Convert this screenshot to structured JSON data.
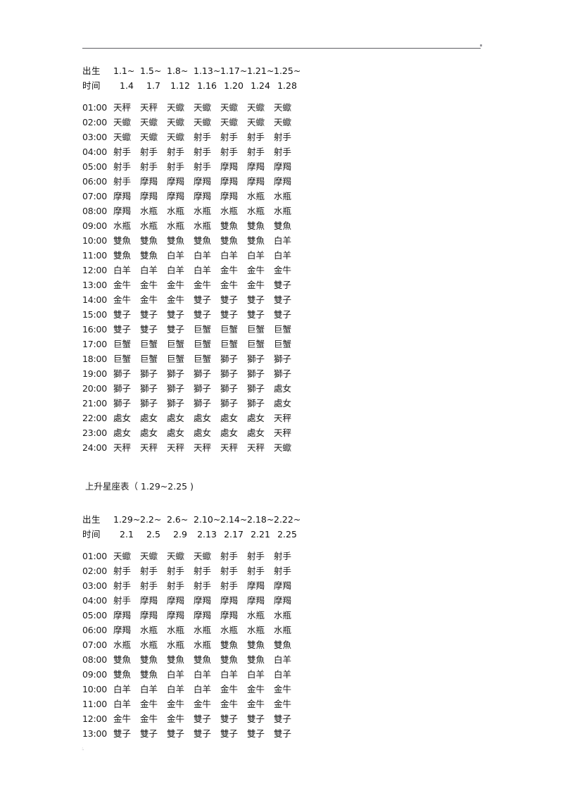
{
  "document": {
    "header_rule": "horizontal-rule",
    "footer_mark": ":."
  },
  "table1": {
    "birth_label": "出生",
    "time_label": "时间",
    "range_start": [
      "1.1~",
      "1.5~",
      "1.8~",
      "1.13~",
      "1.17~",
      "1.21~",
      "1.25~"
    ],
    "range_end": [
      "1.4",
      "1.7",
      "1.12",
      "1.16",
      "1.20",
      "1.24",
      "1.28"
    ],
    "rows": [
      {
        "hour": "01:00",
        "signs": [
          "天秤",
          "天秤",
          "天蠍",
          "天蠍",
          "天蠍",
          "天蠍",
          "天蠍"
        ]
      },
      {
        "hour": "02:00",
        "signs": [
          "天蠍",
          "天蠍",
          "天蠍",
          "天蠍",
          "天蠍",
          "天蠍",
          "天蠍"
        ]
      },
      {
        "hour": "03:00",
        "signs": [
          "天蠍",
          "天蠍",
          "天蠍",
          "射手",
          "射手",
          "射手",
          "射手"
        ]
      },
      {
        "hour": "04:00",
        "signs": [
          "射手",
          "射手",
          "射手",
          "射手",
          "射手",
          "射手",
          "射手"
        ]
      },
      {
        "hour": "05:00",
        "signs": [
          "射手",
          "射手",
          "射手",
          "射手",
          "摩羯",
          "摩羯",
          "摩羯"
        ]
      },
      {
        "hour": "06:00",
        "signs": [
          "射手",
          "摩羯",
          "摩羯",
          "摩羯",
          "摩羯",
          "摩羯",
          "摩羯"
        ]
      },
      {
        "hour": "07:00",
        "signs": [
          "摩羯",
          "摩羯",
          "摩羯",
          "摩羯",
          "摩羯",
          "水瓶",
          "水瓶"
        ]
      },
      {
        "hour": "08:00",
        "signs": [
          "摩羯",
          "水瓶",
          "水瓶",
          "水瓶",
          "水瓶",
          "水瓶",
          "水瓶"
        ]
      },
      {
        "hour": "09:00",
        "signs": [
          "水瓶",
          "水瓶",
          "水瓶",
          "水瓶",
          "雙魚",
          "雙魚",
          "雙魚"
        ]
      },
      {
        "hour": "10:00",
        "signs": [
          "雙魚",
          "雙魚",
          "雙魚",
          "雙魚",
          "雙魚",
          "雙魚",
          "白羊"
        ]
      },
      {
        "hour": "11:00",
        "signs": [
          "雙魚",
          "雙魚",
          "白羊",
          "白羊",
          "白羊",
          "白羊",
          "白羊"
        ]
      },
      {
        "hour": "12:00",
        "signs": [
          "白羊",
          "白羊",
          "白羊",
          "白羊",
          "金牛",
          "金牛",
          "金牛"
        ]
      },
      {
        "hour": "13:00",
        "signs": [
          "金牛",
          "金牛",
          "金牛",
          "金牛",
          "金牛",
          "金牛",
          "雙子"
        ]
      },
      {
        "hour": "14:00",
        "signs": [
          "金牛",
          "金牛",
          "金牛",
          "雙子",
          "雙子",
          "雙子",
          "雙子"
        ]
      },
      {
        "hour": "15:00",
        "signs": [
          "雙子",
          "雙子",
          "雙子",
          "雙子",
          "雙子",
          "雙子",
          "雙子"
        ]
      },
      {
        "hour": "16:00",
        "signs": [
          "雙子",
          "雙子",
          "雙子",
          "巨蟹",
          "巨蟹",
          "巨蟹",
          "巨蟹"
        ]
      },
      {
        "hour": "17:00",
        "signs": [
          "巨蟹",
          "巨蟹",
          "巨蟹",
          "巨蟹",
          "巨蟹",
          "巨蟹",
          "巨蟹"
        ]
      },
      {
        "hour": "18:00",
        "signs": [
          "巨蟹",
          "巨蟹",
          "巨蟹",
          "巨蟹",
          "獅子",
          "獅子",
          "獅子"
        ]
      },
      {
        "hour": "19:00",
        "signs": [
          "獅子",
          "獅子",
          "獅子",
          "獅子",
          "獅子",
          "獅子",
          "獅子"
        ]
      },
      {
        "hour": "20:00",
        "signs": [
          "獅子",
          "獅子",
          "獅子",
          "獅子",
          "獅子",
          "獅子",
          "處女"
        ]
      },
      {
        "hour": "21:00",
        "signs": [
          "獅子",
          "獅子",
          "獅子",
          "獅子",
          "獅子",
          "獅子",
          "處女"
        ]
      },
      {
        "hour": "22:00",
        "signs": [
          "處女",
          "處女",
          "處女",
          "處女",
          "處女",
          "處女",
          "天秤"
        ]
      },
      {
        "hour": "23:00",
        "signs": [
          "處女",
          "處女",
          "處女",
          "處女",
          "處女",
          "處女",
          "天秤"
        ]
      },
      {
        "hour": "24:00",
        "signs": [
          "天秤",
          "天秤",
          "天秤",
          "天秤",
          "天秤",
          "天秤",
          "天蠍"
        ]
      }
    ]
  },
  "section2": {
    "title": "上升星座表（ 1.29~2.25 )"
  },
  "table2": {
    "birth_label": "出生",
    "time_label": "时间",
    "range_start": [
      "1.29~",
      "2.2~",
      "2.6~",
      "2.10~",
      "2.14~",
      "2.18~",
      "2.22~"
    ],
    "range_end": [
      "2.1",
      "2.5",
      "2.9",
      "2.13",
      "2.17",
      "2.21",
      "2.25"
    ],
    "rows": [
      {
        "hour": "01:00",
        "signs": [
          "天蠍",
          "天蠍",
          "天蠍",
          "天蠍",
          "射手",
          "射手",
          "射手"
        ]
      },
      {
        "hour": "02:00",
        "signs": [
          "射手",
          "射手",
          "射手",
          "射手",
          "射手",
          "射手",
          "射手"
        ]
      },
      {
        "hour": "03:00",
        "signs": [
          "射手",
          "射手",
          "射手",
          "射手",
          "射手",
          "摩羯",
          "摩羯"
        ]
      },
      {
        "hour": "04:00",
        "signs": [
          "射手",
          "摩羯",
          "摩羯",
          "摩羯",
          "摩羯",
          "摩羯",
          "摩羯"
        ]
      },
      {
        "hour": "05:00",
        "signs": [
          "摩羯",
          "摩羯",
          "摩羯",
          "摩羯",
          "摩羯",
          "水瓶",
          "水瓶"
        ]
      },
      {
        "hour": "06:00",
        "signs": [
          "摩羯",
          "水瓶",
          "水瓶",
          "水瓶",
          "水瓶",
          "水瓶",
          "水瓶"
        ]
      },
      {
        "hour": "07:00",
        "signs": [
          "水瓶",
          "水瓶",
          "水瓶",
          "水瓶",
          "雙魚",
          "雙魚",
          "雙魚"
        ]
      },
      {
        "hour": "08:00",
        "signs": [
          "雙魚",
          "雙魚",
          "雙魚",
          "雙魚",
          "雙魚",
          "雙魚",
          "白羊"
        ]
      },
      {
        "hour": "09:00",
        "signs": [
          "雙魚",
          "雙魚",
          "白羊",
          "白羊",
          "白羊",
          "白羊",
          "白羊"
        ]
      },
      {
        "hour": "10:00",
        "signs": [
          "白羊",
          "白羊",
          "白羊",
          "白羊",
          "金牛",
          "金牛",
          "金牛"
        ]
      },
      {
        "hour": "11:00",
        "signs": [
          "白羊",
          "金牛",
          "金牛",
          "金牛",
          "金牛",
          "金牛",
          "金牛"
        ]
      },
      {
        "hour": "12:00",
        "signs": [
          "金牛",
          "金牛",
          "金牛",
          "雙子",
          "雙子",
          "雙子",
          "雙子"
        ]
      },
      {
        "hour": "13:00",
        "signs": [
          "雙子",
          "雙子",
          "雙子",
          "雙子",
          "雙子",
          "雙子",
          "雙子"
        ]
      }
    ]
  }
}
